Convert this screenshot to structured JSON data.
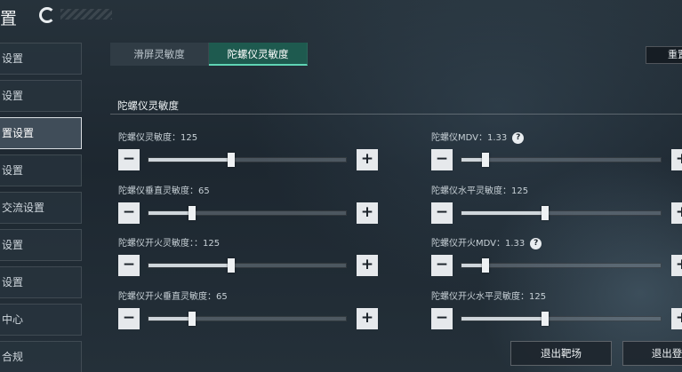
{
  "header": {
    "title": "置"
  },
  "sidebar": {
    "items": [
      {
        "label": "设置",
        "active": false
      },
      {
        "label": "设置",
        "active": false
      },
      {
        "label": "置设置",
        "active": true
      },
      {
        "label": "设置",
        "active": false
      },
      {
        "label": "交流设置",
        "active": false
      },
      {
        "label": "设置",
        "active": false
      },
      {
        "label": "设置",
        "active": false
      },
      {
        "label": "中心",
        "active": false
      },
      {
        "label": "合规",
        "active": false
      }
    ]
  },
  "tabs": [
    {
      "label": "滑屏灵敏度",
      "active": false
    },
    {
      "label": "陀螺仪灵敏度",
      "active": true
    }
  ],
  "reset_label": "重置",
  "section_title": "陀螺仪灵敏度",
  "settings": [
    {
      "label": "陀螺仪灵敏度：125",
      "value": 125,
      "fraction": 0.42,
      "help": false
    },
    {
      "label": "陀螺仪MDV：1.33",
      "value": 1.33,
      "fraction": 0.12,
      "help": true
    },
    {
      "label": "陀螺仪垂直灵敏度：65",
      "value": 65,
      "fraction": 0.22,
      "help": false
    },
    {
      "label": "陀螺仪水平灵敏度：125",
      "value": 125,
      "fraction": 0.42,
      "help": false
    },
    {
      "label": "陀螺仪开火灵敏度：：125",
      "value": 125,
      "fraction": 0.42,
      "help": false
    },
    {
      "label": "陀螺仪开火MDV：1.33",
      "value": 1.33,
      "fraction": 0.12,
      "help": true
    },
    {
      "label": "陀螺仪开火垂直灵敏度：65",
      "value": 65,
      "fraction": 0.22,
      "help": false
    },
    {
      "label": "陀螺仪开火水平灵敏度：125",
      "value": 125,
      "fraction": 0.42,
      "help": false
    }
  ],
  "stepper": {
    "minus": "−",
    "plus": "+",
    "help": "?"
  },
  "footer": {
    "exit_range": "退出靶场",
    "logout": "退出登"
  }
}
